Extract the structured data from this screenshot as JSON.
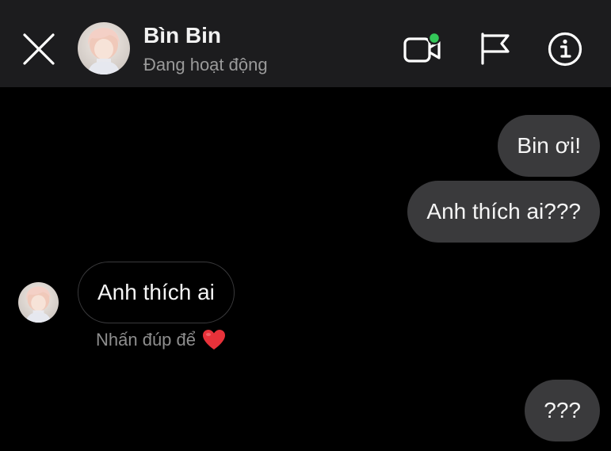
{
  "header": {
    "name": "Bìn Bin",
    "status": "Đang hoạt động"
  },
  "icons": {
    "close": "close-icon",
    "video": "video-call-icon",
    "flag": "flag-icon",
    "info": "info-icon",
    "heart": "heart-icon"
  },
  "colors": {
    "online_dot": "#34c759",
    "heart": "#e8323a",
    "my_bubble": "#3a3a3c"
  },
  "messages": [
    {
      "sender": "me",
      "text": "Bin ơi!"
    },
    {
      "sender": "me",
      "text": "Anh thích ai???"
    },
    {
      "sender": "them",
      "text": "Anh thích ai"
    },
    {
      "sender": "me",
      "text": "???"
    }
  ],
  "hint": {
    "double_tap": "Nhấn đúp để"
  }
}
